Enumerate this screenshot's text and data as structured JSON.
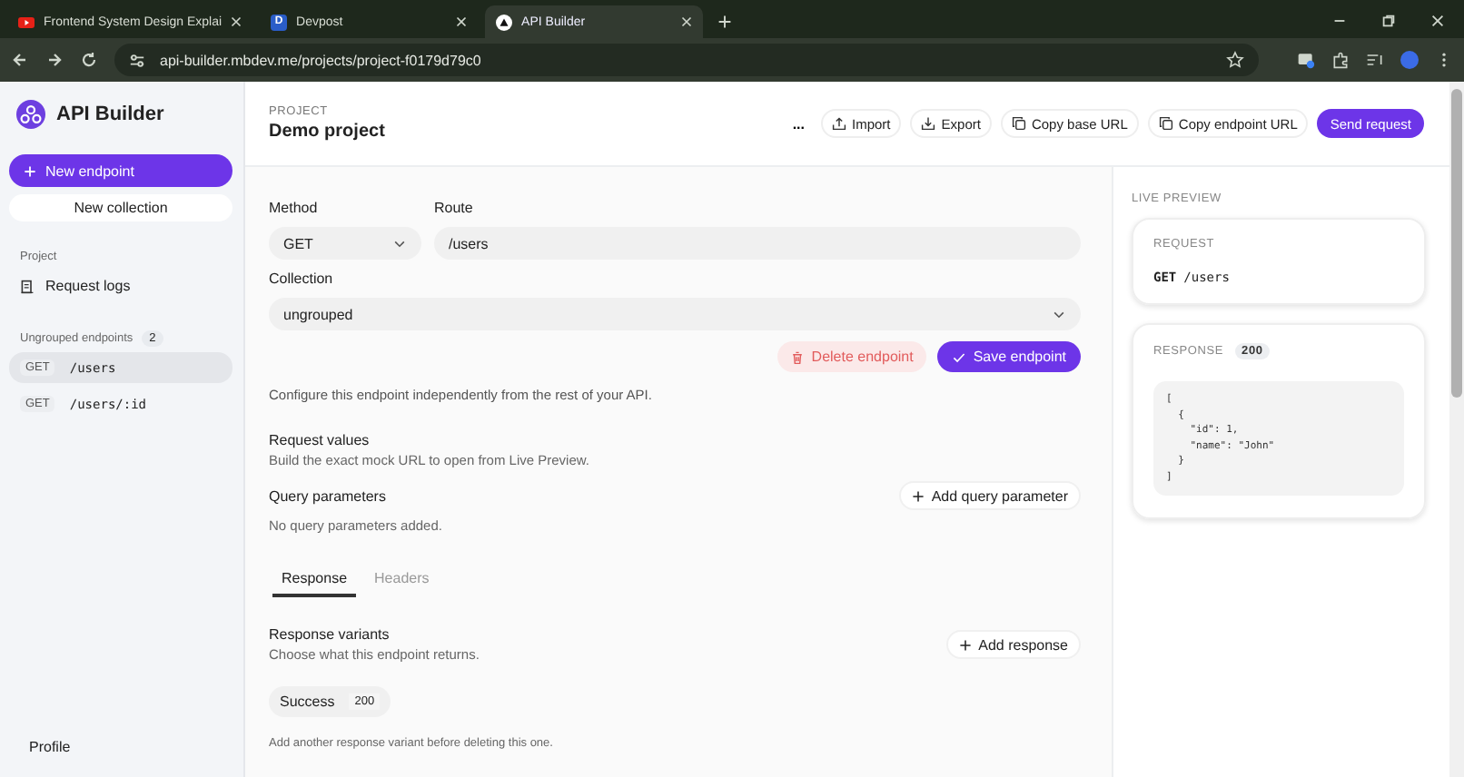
{
  "browser": {
    "tabs": [
      {
        "title": "Frontend System Design Explai",
        "kind": "video",
        "selected": false
      },
      {
        "title": "Devpost",
        "kind": "letter",
        "icon_letter": "D",
        "selected": false
      },
      {
        "title": "API Builder",
        "kind": "app",
        "selected": true
      }
    ],
    "address": "api-builder.mbdev.me/projects/project-f0179d79c0"
  },
  "sidebar": {
    "app_name": "API Builder",
    "new_endpoint": "New endpoint",
    "new_collection": "New collection",
    "section_label": "Project",
    "request_logs": "Request logs",
    "group": {
      "label": "Ungrouped endpoints",
      "count": "2"
    },
    "endpoints": [
      {
        "method": "GET",
        "path": "/users",
        "selected": true
      },
      {
        "method": "GET",
        "path": "/users/:id",
        "selected": false
      }
    ],
    "profile": "Profile"
  },
  "header": {
    "eyebrow": "PROJECT",
    "title": "Demo project",
    "more": "...",
    "actions": [
      {
        "label": "Import",
        "kind": "import"
      },
      {
        "label": "Export",
        "kind": "export"
      },
      {
        "label": "Copy base URL",
        "kind": "copy"
      },
      {
        "label": "Copy endpoint URL",
        "kind": "copy"
      }
    ],
    "primary": "Send request"
  },
  "form": {
    "method_label": "Method",
    "method": "GET",
    "route_label": "Route",
    "route": "/users",
    "collection_label": "Collection",
    "collection": "ungrouped",
    "delete": "Delete endpoint",
    "save": "Save endpoint",
    "note": "Configure this endpoint independently from the rest of your API.",
    "request_values": {
      "title": "Request values",
      "subtitle": "Build the exact mock URL to open from Live Preview."
    },
    "query": {
      "title": "Query parameters",
      "add": "Add query parameter",
      "empty": "No query parameters added."
    },
    "tabs": [
      {
        "label": "Response",
        "selected": true
      },
      {
        "label": "Headers",
        "selected": false
      }
    ],
    "variants": {
      "title": "Response variants",
      "subtitle": "Choose what this endpoint returns.",
      "add": "Add response",
      "items": [
        {
          "name": "Success",
          "code": "200"
        }
      ],
      "hint": "Add another response variant before deleting this one."
    }
  },
  "preview": {
    "title": "LIVE PREVIEW",
    "request_label": "REQUEST",
    "method": "GET",
    "path": "/users",
    "response_label": "RESPONSE",
    "status": "200",
    "body": "[\n  {\n    \"id\": 1,\n    \"name\": \"John\"\n  }\n]"
  }
}
